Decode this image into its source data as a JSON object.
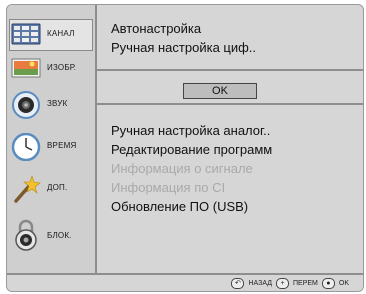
{
  "sidebar": {
    "items": [
      {
        "label": "КАНАЛ",
        "icon": "tv-channel-icon"
      },
      {
        "label": "ИЗОБР.",
        "icon": "picture-icon"
      },
      {
        "label": "ЗВУК",
        "icon": "speaker-icon"
      },
      {
        "label": "ВРЕМЯ",
        "icon": "clock-icon"
      },
      {
        "label": "ДОП.",
        "icon": "magic-wand-icon"
      },
      {
        "label": "БЛОК.",
        "icon": "lock-icon"
      }
    ]
  },
  "main": {
    "auto_tune": "Автонастройка",
    "manual_digital": "Ручная настройка циф..",
    "ok_label": "OK",
    "manual_analog": "Ручная настройка аналог..",
    "edit_programs": "Редактирование программ",
    "signal_info": "Информация о сигнале",
    "ci_info": "Информация по CI",
    "update_usb": "Обновление ПО (USB)"
  },
  "footer": {
    "back_label": "НАЗАД",
    "move_label": "ПЕРЕМ",
    "ok_label": "OK"
  },
  "colors": {
    "background": "#d6d6d6",
    "disabled_text": "#a9a9a9",
    "divider": "#8e8e8e"
  }
}
